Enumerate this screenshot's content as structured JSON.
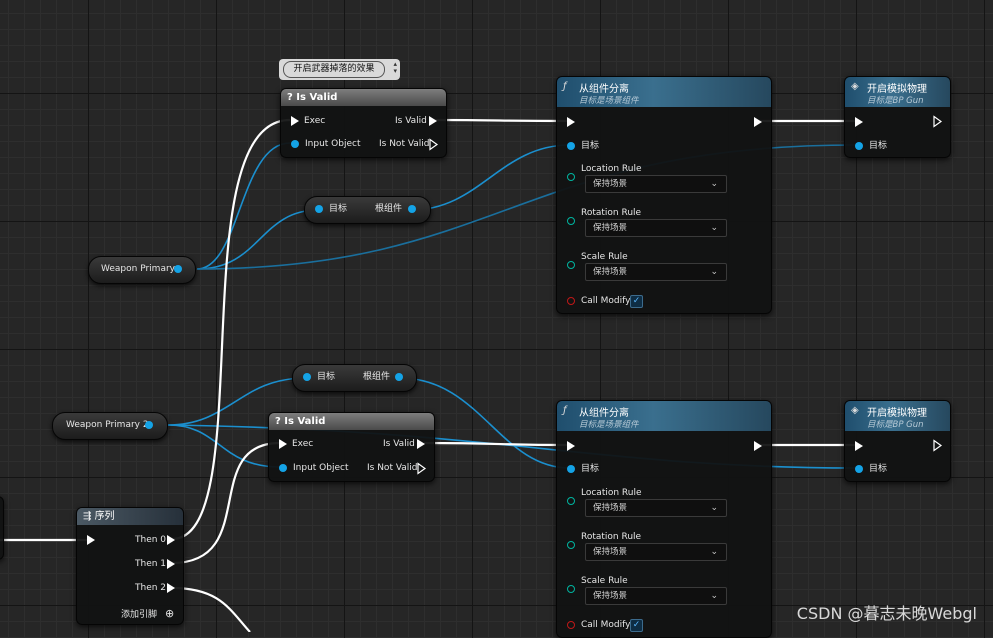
{
  "comment": {
    "text": "开启武器掉落的效果",
    "icon": "pin-icon"
  },
  "is_valid": {
    "title": "Is Valid",
    "icon": "question-icon",
    "exec": "Exec",
    "input_object": "Input Object",
    "is_valid": "Is Valid",
    "is_not_valid": "Is Not Valid"
  },
  "detach": {
    "title": "从组件分离",
    "subtitle": "目标是场景组件",
    "icon": "function-icon",
    "target": "目标",
    "location_rule": "Location Rule",
    "rotation_rule": "Rotation Rule",
    "scale_rule": "Scale Rule",
    "rule_value": "保持场景",
    "call_modify": "Call Modify",
    "call_modify_checked": true
  },
  "physics": {
    "title": "开启模拟物理",
    "subtitle": "目标是BP Gun",
    "icon": "diamond-icon",
    "target": "目标"
  },
  "root_getter": {
    "target": "目标",
    "output": "根组件"
  },
  "vars": {
    "weapon_primary": "Weapon Primary",
    "weapon_primary_2": "Weapon Primary 2"
  },
  "sequence": {
    "title": "序列",
    "icon": "sequence-icon",
    "then0": "Then 0",
    "then1": "Then 1",
    "then2": "Then 2",
    "add_pin": "添加引脚"
  },
  "colors": {
    "exec_wire": "#ffffff",
    "object_wire": "#1b8fce",
    "object_pin": "#14a3e6"
  },
  "watermark": "CSDN @暮志未晚Webgl"
}
